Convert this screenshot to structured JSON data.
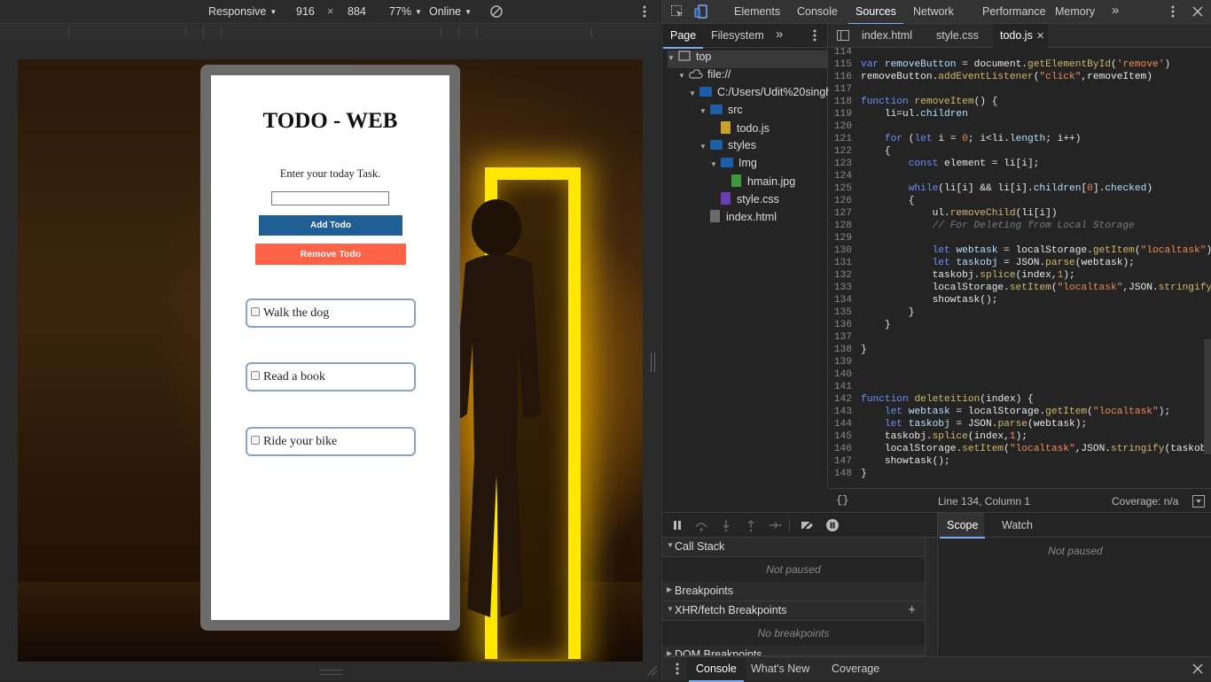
{
  "device_toolbar": {
    "device": "Responsive",
    "width": "916",
    "times": "×",
    "height": "884",
    "zoom": "77%",
    "throttle": "Online"
  },
  "todo_app": {
    "title": "TODO - WEB",
    "prompt": "Enter your today Task.",
    "input_value": "",
    "add_label": "Add Todo",
    "remove_label": "Remove Todo",
    "items": [
      {
        "text": "Walk the dog",
        "checked": false
      },
      {
        "text": "Read a book",
        "checked": false
      },
      {
        "text": "Ride your bike",
        "checked": false
      }
    ],
    "colors": {
      "add": "#1f5f96",
      "remove": "#ff6347"
    }
  },
  "devtools": {
    "tabs": [
      "Elements",
      "Console",
      "Sources",
      "Network",
      "Performance",
      "Memory"
    ],
    "active_tab": "Sources",
    "more": "»",
    "navigator_tabs": [
      "Page",
      "Filesystem"
    ],
    "tree": [
      {
        "label": "top",
        "type": "frame"
      },
      {
        "label": "file://",
        "type": "cloud"
      },
      {
        "label": "C:/Users/Udit%20singh/",
        "type": "folder"
      },
      {
        "label": "src",
        "type": "folder"
      },
      {
        "label": "todo.js",
        "type": "js"
      },
      {
        "label": "styles",
        "type": "folder"
      },
      {
        "label": "Img",
        "type": "folder"
      },
      {
        "label": "hmain.jpg",
        "type": "img"
      },
      {
        "label": "style.css",
        "type": "css"
      },
      {
        "label": "index.html",
        "type": "html"
      }
    ],
    "editor_tabs": [
      "index.html",
      "style.css",
      "todo.js"
    ],
    "active_file": "todo.js",
    "status": {
      "position": "Line 134, Column 1",
      "coverage": "Coverage: n/a",
      "braces": "{}"
    },
    "debugger": {
      "call_stack": "Call Stack",
      "not_paused": "Not paused",
      "breakpoints": "Breakpoints",
      "xhr": "XHR/fetch Breakpoints",
      "no_breakpoints": "No breakpoints",
      "dom": "DOM Breakpoints",
      "scope": "Scope",
      "watch": "Watch",
      "scope_not_paused": "Not paused"
    },
    "drawer_tabs": [
      "Console",
      "What's New",
      "Coverage"
    ]
  }
}
